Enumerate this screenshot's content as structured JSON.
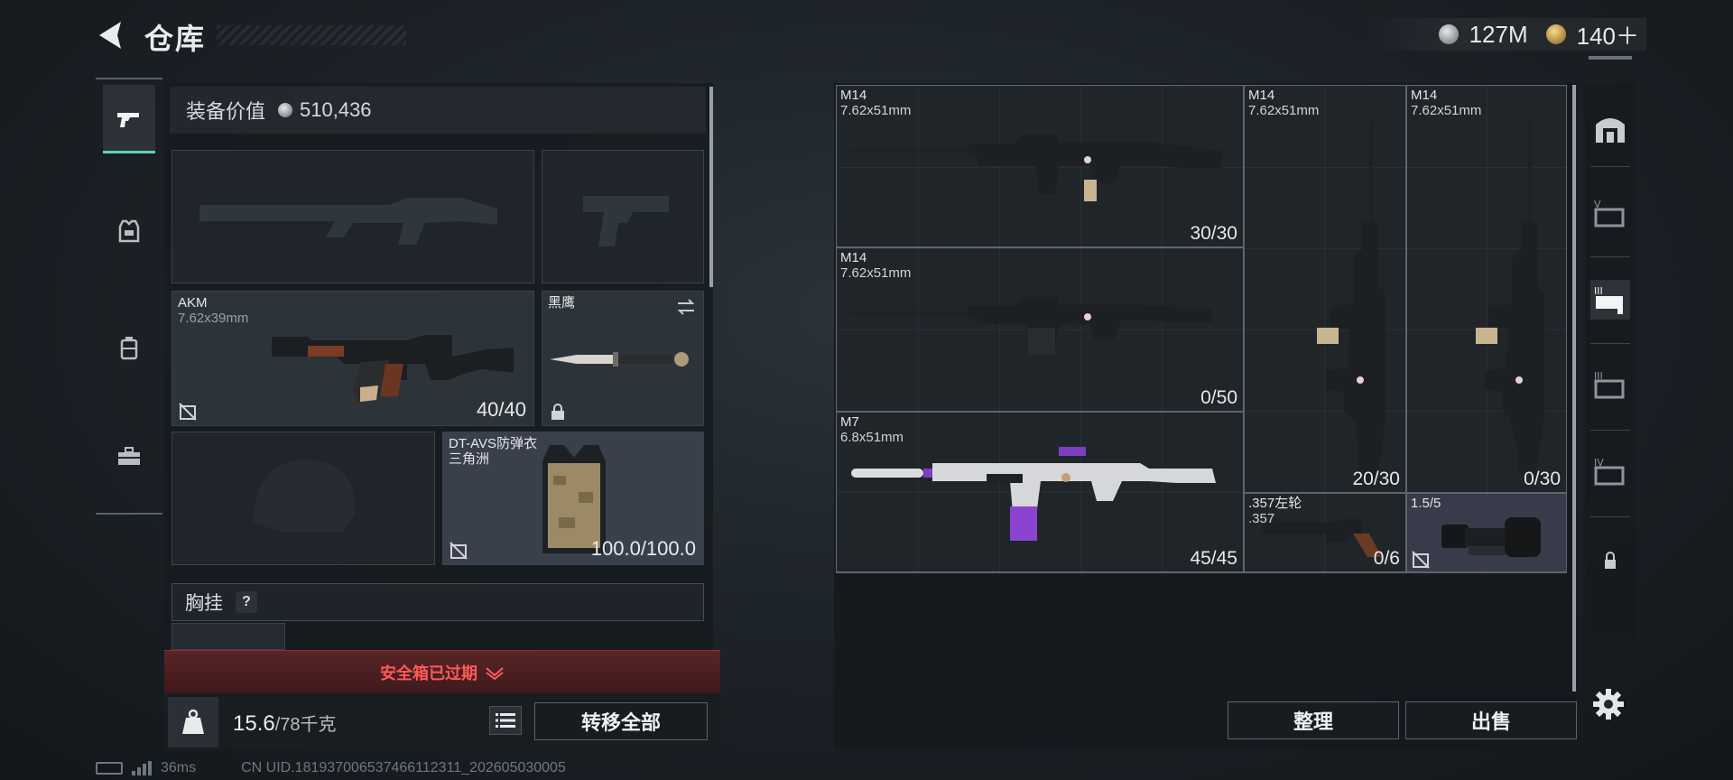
{
  "header": {
    "title": "仓库",
    "currencies": [
      {
        "icon": "silver-coin-icon",
        "value": "127M"
      },
      {
        "icon": "gold-coin-icon",
        "value": "140＋"
      }
    ]
  },
  "equipment": {
    "value_label": "装备价值",
    "value": "510,436",
    "slots": {
      "primary_empty": {
        "icon": "rifle-silhouette-icon"
      },
      "pistol_empty": {
        "icon": "pistol-silhouette-icon"
      },
      "primary": {
        "name": "AKM",
        "caliber": "7.62x39mm",
        "count": "40/40"
      },
      "melee": {
        "name": "黑鹰"
      },
      "helmet_empty": {
        "icon": "helmet-silhouette-icon"
      },
      "armor": {
        "name": "DT-AVS防弹衣",
        "sub": "三角洲",
        "count": "100.0/100.0"
      }
    },
    "vest_label": "胸挂",
    "vest_help": "?",
    "safe_box_status": "安全箱已过期",
    "weight": {
      "current": "15.6",
      "max": "/78千克"
    },
    "transfer_all": "转移全部"
  },
  "storage": {
    "items": [
      {
        "name": "M14",
        "caliber": "7.62x51mm",
        "count": "30/30"
      },
      {
        "name": "M14",
        "caliber": "7.62x51mm",
        "count": "20/30"
      },
      {
        "name": "M14",
        "caliber": "7.62x51mm",
        "count": "0/30"
      },
      {
        "name": "M14",
        "caliber": "7.62x51mm",
        "count": "0/50"
      },
      {
        "name": "M7",
        "caliber": "6.8x51mm",
        "count": "45/45"
      },
      {
        "name": ".357左轮",
        "caliber": ".357",
        "count": "0/6"
      },
      {
        "name": "1.5/5",
        "caliber": "",
        "count": ""
      }
    ],
    "sort_label": "整理",
    "sell_label": "出售"
  },
  "status": {
    "ping": "36ms",
    "uid": "CN UID.181937006537466112311_202605030005"
  },
  "colors": {
    "accent": "#5fd3b5",
    "warning": "#ff5a58",
    "scope_bg": "#3c3e4e"
  }
}
